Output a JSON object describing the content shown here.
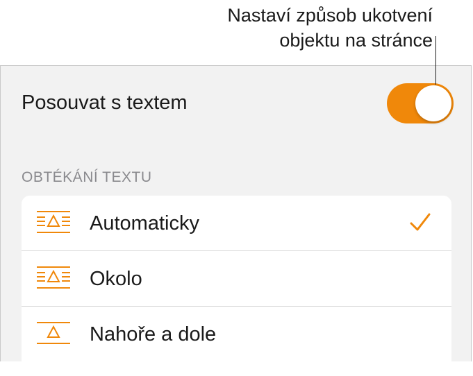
{
  "callout": {
    "line1": "Nastaví způsob ukotvení",
    "line2": "objektu na stránce"
  },
  "toggle_row": {
    "label": "Posouvat s textem",
    "on": true
  },
  "wrap_section": {
    "header": "OBTÉKÁNÍ TEXTU",
    "options": [
      {
        "label": "Automaticky",
        "icon": "wrap-automatic-icon",
        "selected": true
      },
      {
        "label": "Okolo",
        "icon": "wrap-around-icon",
        "selected": false
      },
      {
        "label": "Nahoře a dole",
        "icon": "wrap-above-below-icon",
        "selected": false
      }
    ]
  },
  "colors": {
    "accent": "#f0880a",
    "panel_bg": "#f2f2f2",
    "section_header": "#8a8a8e"
  }
}
